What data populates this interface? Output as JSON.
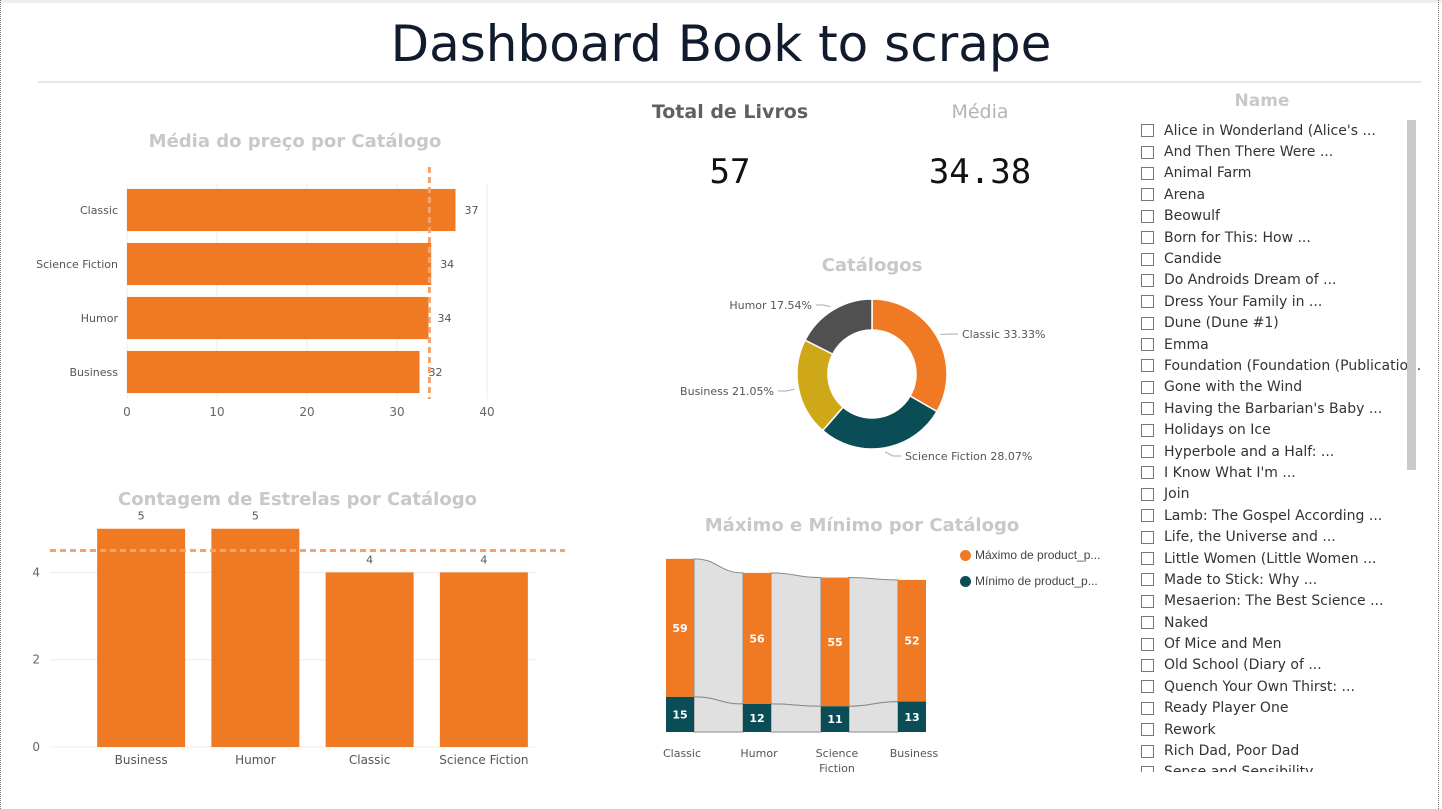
{
  "title": "Dashboard Book to scrape",
  "kpis": {
    "total": {
      "label": "Total de Livros",
      "value": "57"
    },
    "media": {
      "label": "Média",
      "value": "34.38"
    }
  },
  "colors": {
    "orange": "#F07A24",
    "teal": "#0B4D57",
    "gray": "#505050",
    "mustard": "#CFA81A",
    "ribbon": "#E0E0E0"
  },
  "chart_data": [
    {
      "type": "bar",
      "orientation": "horizontal",
      "title": "Média do preço por  Catálogo",
      "categories": [
        "Classic",
        "Science Fiction",
        "Humor",
        "Business"
      ],
      "values": [
        36.5,
        33.8,
        33.5,
        32.5
      ],
      "data_labels": [
        "37",
        "34",
        "34",
        "32"
      ],
      "xlim": [
        0,
        40
      ],
      "xticks": [
        0,
        10,
        20,
        30,
        40
      ],
      "reference_line": 33.6,
      "grid": true
    },
    {
      "type": "bar",
      "title": "Contagem de Estrelas por Catálogo",
      "categories": [
        "Business",
        "Humor",
        "Classic",
        "Science Fiction"
      ],
      "values": [
        5,
        5,
        4,
        4
      ],
      "data_labels": [
        "5",
        "5",
        "4",
        "4"
      ],
      "ylim": [
        0,
        5.2
      ],
      "yticks": [
        0,
        2,
        4
      ],
      "reference_line": 4.5,
      "grid": true
    },
    {
      "type": "pie",
      "donut": true,
      "title": "Catálogos",
      "slices": [
        {
          "name": "Classic",
          "percent": 33.33,
          "label": "Classic 33.33%",
          "color": "#F07A24"
        },
        {
          "name": "Science Fiction",
          "percent": 28.07,
          "label": "Science Fiction 28.07%",
          "color": "#0B4D57"
        },
        {
          "name": "Business",
          "percent": 21.05,
          "label": "Business 21.05%",
          "color": "#CFA81A"
        },
        {
          "name": "Humor",
          "percent": 17.54,
          "label": "Humor 17.54%",
          "color": "#505050"
        }
      ]
    },
    {
      "type": "bar",
      "stacked": true,
      "ribbon": true,
      "title": "Máximo e Mínimo por Catálogo",
      "categories": [
        "Classic",
        "Humor",
        "Science Fiction",
        "Business"
      ],
      "category_labels": [
        [
          "Classic"
        ],
        [
          "Humor"
        ],
        [
          "Science",
          "Fiction"
        ],
        [
          "Business"
        ]
      ],
      "series": [
        {
          "name": "Mínimo de product_p...",
          "values": [
            15,
            12,
            11,
            13
          ],
          "color": "#0B4D57"
        },
        {
          "name": "Máximo de product_p...",
          "values": [
            59,
            56,
            55,
            52
          ],
          "color": "#F07A24"
        }
      ],
      "legend": "right"
    }
  ],
  "slicer": {
    "title": "Name",
    "items": [
      "Alice in Wonderland (Alice's ...",
      "And Then There Were ...",
      "Animal Farm",
      "Arena",
      "Beowulf",
      "Born for This: How ...",
      "Candide",
      "Do Androids Dream of ...",
      "Dress Your Family in ...",
      "Dune (Dune #1)",
      "Emma",
      "Foundation (Foundation (Publicatio...",
      "Gone with the Wind",
      "Having the Barbarian's Baby ...",
      "Holidays on Ice",
      "Hyperbole and a Half: ...",
      "I Know What I'm ...",
      "Join",
      "Lamb: The Gospel According ...",
      "Life, the Universe and ...",
      "Little Women (Little Women ...",
      "Made to Stick: Why ...",
      "Mesaerion: The Best Science ...",
      "Naked",
      "Of Mice and Men",
      "Old School (Diary of ...",
      "Quench Your Own Thirst: ...",
      "Ready Player One",
      "Rework",
      "Rich Dad, Poor Dad",
      "Sense and Sensibility"
    ]
  }
}
